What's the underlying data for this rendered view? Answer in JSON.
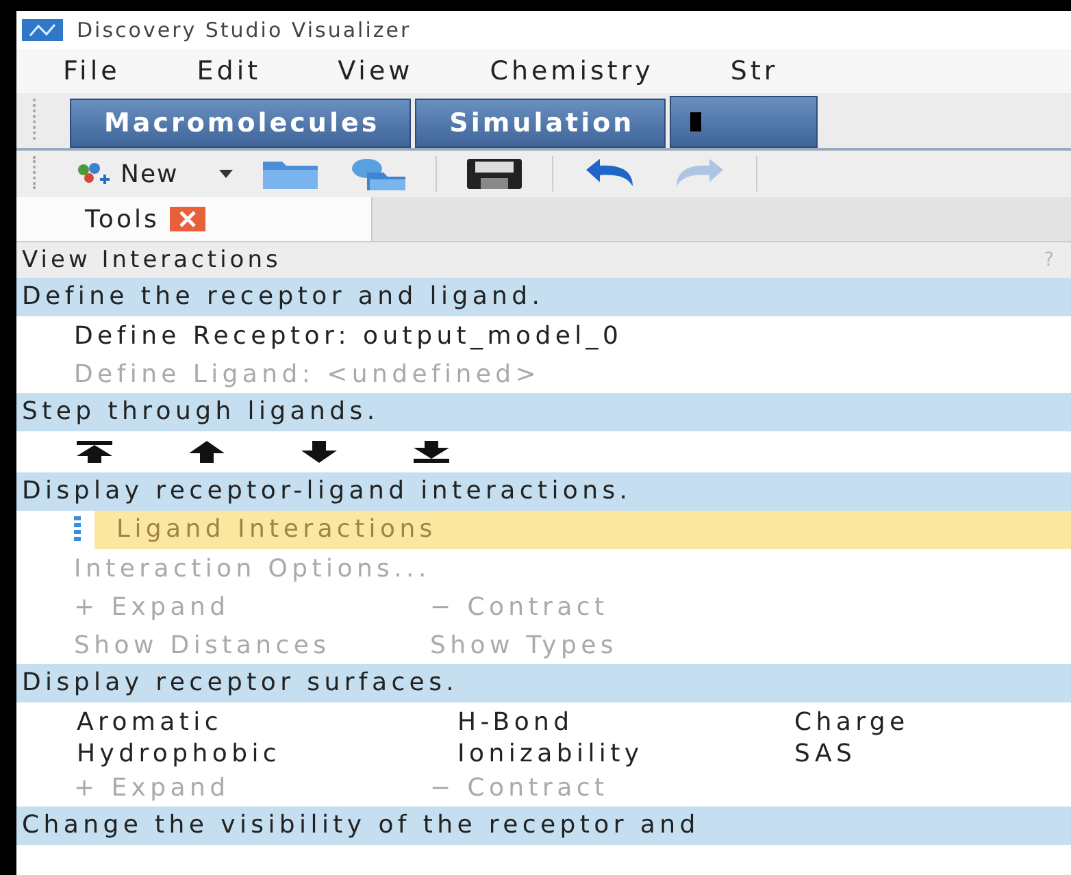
{
  "window": {
    "title": "Discovery Studio Visualizer"
  },
  "menu": [
    "File",
    "Edit",
    "View",
    "Chemistry",
    "Str"
  ],
  "ribbon_tabs": [
    {
      "label": "Macromolecules"
    },
    {
      "label": "Simulation"
    }
  ],
  "toolbar": [
    {
      "kind": "new",
      "label": "New",
      "disabled": false
    },
    {
      "kind": "open",
      "disabled": false
    },
    {
      "kind": "remote",
      "disabled": false
    },
    {
      "kind": "save",
      "disabled": false
    },
    {
      "kind": "undo",
      "disabled": false
    },
    {
      "kind": "redo",
      "disabled": true
    }
  ],
  "panel_tab": {
    "label": "Tools"
  },
  "panel": {
    "title": "View Interactions",
    "help": "?"
  },
  "sections": [
    {
      "header": "Define the receptor and ligand.",
      "rows": [
        {
          "kind": "links",
          "links": [
            {
              "label": "Define Receptor: output_model_0",
              "disabled": false
            }
          ]
        },
        {
          "kind": "links",
          "links": [
            {
              "label": "Define Ligand: <undefined>",
              "disabled": true
            }
          ]
        }
      ]
    },
    {
      "header": "Step through ligands.",
      "rows": [
        {
          "kind": "nav",
          "buttons": [
            {
              "kind": "first"
            },
            {
              "kind": "prev"
            },
            {
              "kind": "next"
            },
            {
              "kind": "last"
            }
          ]
        }
      ]
    },
    {
      "header": "Display receptor-ligand interactions.",
      "rows": [
        {
          "kind": "list",
          "items": [
            {
              "label": "Ligand Interactions",
              "selected": true
            }
          ]
        },
        {
          "kind": "links",
          "links": [
            {
              "label": "Interaction Options...",
              "disabled": true
            }
          ]
        },
        {
          "kind": "links",
          "links": [
            {
              "label": "+ Expand",
              "disabled": true
            },
            {
              "label": "− Contract",
              "disabled": true
            }
          ]
        },
        {
          "kind": "links",
          "links": [
            {
              "label": "Show Distances",
              "disabled": true
            },
            {
              "label": "Show Types",
              "disabled": true
            }
          ]
        }
      ]
    },
    {
      "header": "Display receptor surfaces.",
      "rows": [
        {
          "kind": "grid",
          "links": [
            {
              "label": "Aromatic",
              "disabled": false
            },
            {
              "label": "H-Bond",
              "disabled": false
            },
            {
              "label": "Charge",
              "disabled": false
            },
            {
              "label": "Hydrophobic",
              "disabled": false
            },
            {
              "label": "Ionizability",
              "disabled": false
            },
            {
              "label": "SAS",
              "disabled": false
            }
          ]
        },
        {
          "kind": "links",
          "links": [
            {
              "label": "+ Expand",
              "disabled": true
            },
            {
              "label": "− Contract",
              "disabled": true
            }
          ]
        }
      ]
    },
    {
      "header": "Change the visibility of the receptor and"
    }
  ]
}
